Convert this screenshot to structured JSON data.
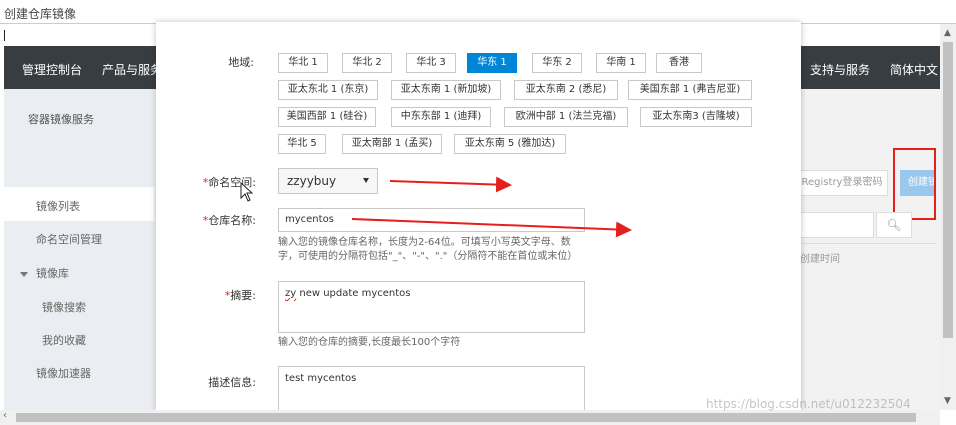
{
  "window": {
    "title": "创建仓库镜像"
  },
  "background": {
    "topnav": {
      "left": [
        "管理控制台",
        "产品与服务"
      ],
      "right": [
        "支持与服务",
        "简体中文"
      ]
    },
    "sidebar": {
      "title": "容器镜像服务",
      "items": [
        "镜像列表",
        "命名空间管理"
      ],
      "group": "镜像库",
      "sub_items": [
        "镜像搜索",
        "我的收藏"
      ],
      "extra": "镜像加速器"
    },
    "right": {
      "registry_button": "Registry登录密码",
      "create_button": "创建镜像仓库",
      "search_icon": "search-icon",
      "column_header": "创建时间"
    }
  },
  "dialog": {
    "region": {
      "label": "地域:",
      "rows": [
        [
          "华北 1",
          "华北 2",
          "华北 3",
          "华东 1",
          "华东 2",
          "华南 1",
          "香港"
        ],
        [
          "亚太东北 1 (东京)",
          "亚太东南 1 (新加坡)",
          "亚太东南 2 (悉尼)",
          "美国东部 1 (弗吉尼亚)"
        ],
        [
          "美国西部 1 (硅谷)",
          "中东东部 1 (迪拜)",
          "欧洲中部 1 (法兰克福)",
          "亚太东南3 (吉隆坡)"
        ],
        [
          "华北 5",
          "亚太南部 1 (孟买)",
          "亚太东南 5 (雅加达)"
        ]
      ],
      "selected": "华东 1"
    },
    "namespace": {
      "required": "*",
      "label": "命名空间:",
      "value": "zzyybuy"
    },
    "repo_name": {
      "required": "*",
      "label": "仓库名称:",
      "value": "mycentos",
      "hint_line1": "输入您的镜像仓库名称，长度为2-64位。可填写小写英文字母、数",
      "hint_line2": "字，可使用的分隔符包括\"_\"、\"-\"、\".\"（分隔符不能在首位或末位）"
    },
    "summary": {
      "required": "*",
      "label": "摘要:",
      "value_prefix": "zy",
      "value_rest": " new update mycentos",
      "hint": "输入您的仓库的摘要,长度最长100个字符"
    },
    "description": {
      "label": "描述信息:",
      "value": "test mycentos"
    }
  },
  "watermark": "https://blog.csdn.net/u012232504",
  "colors": {
    "accent": "#0086d6",
    "annotation": "#e4201c",
    "topnav": "#373d41"
  }
}
